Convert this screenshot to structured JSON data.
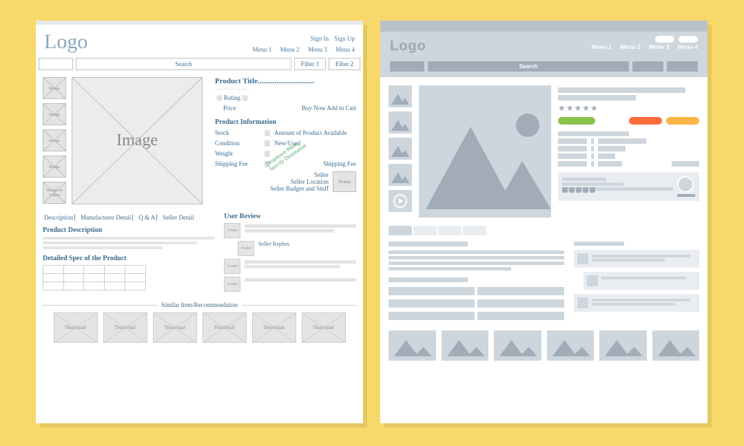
{
  "leftWireframe": {
    "logo": "Logo",
    "auth": {
      "signIn": "Sign In",
      "signUp": "Sign Up"
    },
    "menu": [
      "Menu 1",
      "Menu 2",
      "Menu 3",
      "Menu 4"
    ],
    "search": {
      "placeholder": "Search",
      "filters": [
        "Filter 1",
        "Filter 2"
      ]
    },
    "thumbLabels": [
      "Image",
      "Image",
      "Image",
      "Image",
      "Image or Video"
    ],
    "mainImageLabel": "Image",
    "product": {
      "title": "Product Title..............................",
      "dottedLine": "....................",
      "ratingLabel": "Rating",
      "priceLabel": "Price",
      "buyNow": "Buy Now",
      "addToCart": "Add to Cart",
      "infoHeader": "Product Information",
      "rows": [
        {
          "label": "Stock",
          "value": "Amount of Product Available"
        },
        {
          "label": "Condition",
          "value": "New/Used"
        },
        {
          "label": "Weight",
          "value": ""
        },
        {
          "label": "Shipping Fee",
          "value": "Shipping Fee"
        }
      ],
      "dropdownNote": "Dropdown Menu Specify Destination",
      "seller": {
        "nameLabel": "Seller",
        "locationLabel": "Seller Location",
        "badgesLabel": "Seller Badges and Stuff",
        "avatar": "Avatar"
      }
    },
    "tabs": [
      "Description",
      "Manufacturer Detail",
      "Q & A",
      "Seller Detail"
    ],
    "descriptionHeader": "Product Description",
    "specHeader": "Detailed Spec of the Product",
    "reviewHeader": "User Review",
    "reviewAvatar": "Avatar",
    "sellerReplies": "Seller Replies",
    "recHeader": "Similar Item/Recommendation",
    "recThumb": "Thumbnail"
  },
  "rightMockup": {
    "logo": "Logo",
    "menu": [
      "Menu 1",
      "Menu 2",
      "Menu 3",
      "Menu 4"
    ],
    "searchLabel": "Search"
  }
}
